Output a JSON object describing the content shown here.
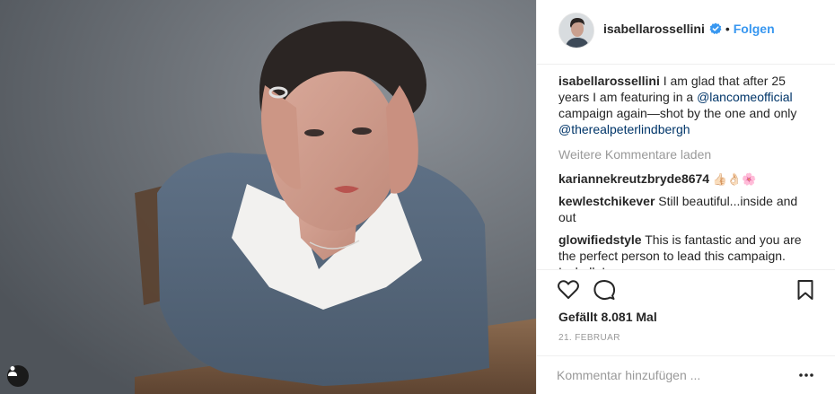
{
  "post": {
    "username": "isabellarossellini",
    "follow_label": "Folgen",
    "dot": "•",
    "accent_color": "#3897f0"
  },
  "caption": {
    "username": "isabellarossellini",
    "text_1": " I am glad that after 25 years I am featuring in a ",
    "mention_1": "@lancomeofficial",
    "text_2": " campaign again—shot by the one and only ",
    "mention_2": "@therealpeterlindbergh"
  },
  "load_more_label": "Weitere Kommentare laden",
  "comments": [
    {
      "username": "kariannekreutzbryde8674",
      "text": " 👍🏻👌🏻🌸"
    },
    {
      "username": "kewlestchikever",
      "text": " Still beautiful...inside and out"
    },
    {
      "username": "glowifiedstyle",
      "text": " This is fantastic and you are the perfect person to lead this campaign. Isabella! xo"
    }
  ],
  "likes_label": "Gefällt 8.081 Mal",
  "date_label": "21. FEBRUAR",
  "add_comment_placeholder": "Kommentar hinzufügen ...",
  "icons": {
    "like": "heart-icon",
    "comment": "comment-icon",
    "save": "bookmark-icon",
    "more": "ellipsis-icon",
    "verified": "verified-badge-icon",
    "user_tag": "person-icon"
  }
}
